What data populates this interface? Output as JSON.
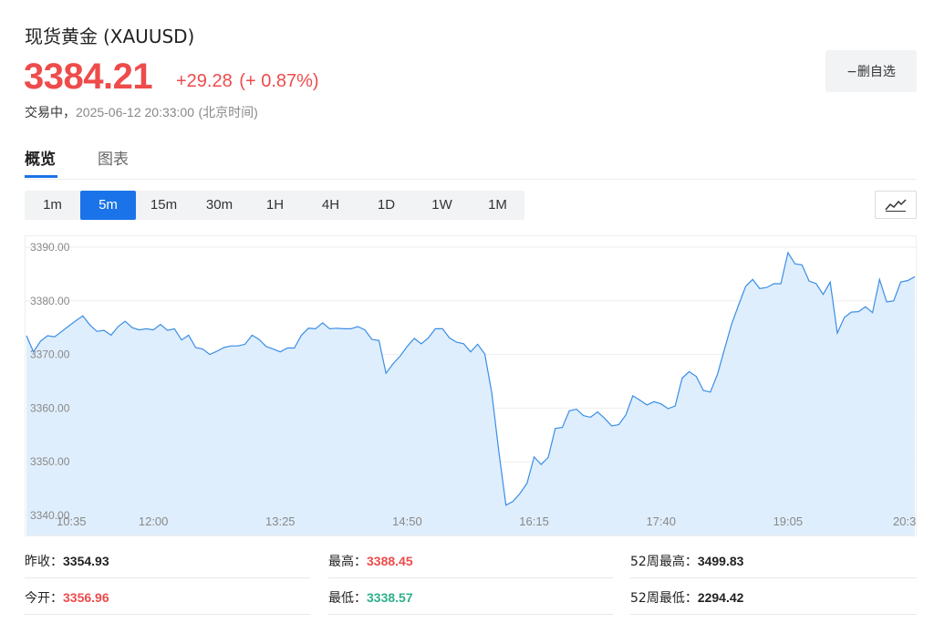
{
  "header": {
    "name": "现货黄金",
    "code": "(XAUUSD)",
    "price": "3384.21",
    "change": "+29.28",
    "change_pct": "(+ 0.87%)",
    "status_label": "交易中，",
    "timestamp": "2025-06-12 20:33:00",
    "timezone": "(北京时间)",
    "up_color": "#ee4b4b"
  },
  "watchlist": {
    "label": "−删自选"
  },
  "tabs": [
    {
      "label": "概览",
      "active": true
    },
    {
      "label": "图表",
      "active": false
    }
  ],
  "intervals": [
    {
      "label": "1m",
      "active": false
    },
    {
      "label": "5m",
      "active": true
    },
    {
      "label": "15m",
      "active": false
    },
    {
      "label": "30m",
      "active": false
    },
    {
      "label": "1H",
      "active": false
    },
    {
      "label": "4H",
      "active": false
    },
    {
      "label": "1D",
      "active": false
    },
    {
      "label": "1W",
      "active": false
    },
    {
      "label": "1M",
      "active": false
    }
  ],
  "chart_type_icon": "line-chart-icon",
  "chart_data": {
    "type": "area",
    "ylim": [
      3340,
      3390
    ],
    "y_ticks": [
      "3390.00",
      "3380.00",
      "3370.00",
      "3360.00",
      "3350.00",
      "3340.00"
    ],
    "x_ticks": [
      {
        "label": "10:35",
        "t": 0
      },
      {
        "label": "12:00",
        "t": 85
      },
      {
        "label": "13:25",
        "t": 170
      },
      {
        "label": "14:50",
        "t": 255
      },
      {
        "label": "16:15",
        "t": 340
      },
      {
        "label": "17:40",
        "t": 425
      },
      {
        "label": "19:05",
        "t": 510
      },
      {
        "label": "20:3",
        "t": 595
      }
    ],
    "x_start": "10:35",
    "x_end": "20:33",
    "interval_minutes": 5,
    "grid": true,
    "line_color": "#3a8ee6",
    "fill_color": "#dfeefc",
    "values": [
      3373.5,
      3370.5,
      3372.5,
      3373.5,
      3373.3,
      3374.3,
      3375.3,
      3376.3,
      3377.2,
      3375.5,
      3374.3,
      3374.5,
      3373.6,
      3375.2,
      3376.2,
      3375.0,
      3374.6,
      3374.8,
      3374.6,
      3375.6,
      3374.5,
      3374.8,
      3372.7,
      3373.6,
      3371.3,
      3371.0,
      3370.0,
      3370.6,
      3371.3,
      3371.6,
      3371.6,
      3371.9,
      3373.6,
      3372.8,
      3371.5,
      3371.0,
      3370.5,
      3371.2,
      3371.2,
      3373.6,
      3374.9,
      3374.8,
      3375.9,
      3374.8,
      3374.9,
      3374.8,
      3374.8,
      3375.2,
      3374.6,
      3372.8,
      3372.6,
      3366.5,
      3368.3,
      3369.7,
      3371.5,
      3373.0,
      3372.0,
      3373.1,
      3374.8,
      3374.8,
      3373.1,
      3372.3,
      3372.0,
      3370.5,
      3371.9,
      3370.1,
      3362.8,
      3351.9,
      3341.9,
      3342.6,
      3344.1,
      3346.0,
      3350.9,
      3349.5,
      3350.8,
      3356.2,
      3356.4,
      3359.5,
      3359.8,
      3358.6,
      3358.3,
      3359.3,
      3358.1,
      3356.7,
      3356.9,
      3358.7,
      3362.3,
      3361.5,
      3360.6,
      3361.2,
      3360.8,
      3359.9,
      3360.4,
      3365.6,
      3366.8,
      3365.9,
      3363.3,
      3363.0,
      3366.3,
      3371.0,
      3375.6,
      3379.2,
      3382.7,
      3384.0,
      3382.3,
      3382.5,
      3383.2,
      3383.2,
      3389.0,
      3386.9,
      3386.7,
      3383.7,
      3383.2,
      3381.2,
      3383.5,
      3374.0,
      3376.9,
      3377.9,
      3378.0,
      3378.9,
      3377.8,
      3384.0,
      3379.8,
      3380.0,
      3383.5,
      3383.8,
      3384.5
    ]
  },
  "stats": [
    [
      {
        "label": "昨收：",
        "value": "3354.93",
        "tone": "dark"
      },
      {
        "label": "最高：",
        "value": "3388.45",
        "tone": "red"
      },
      {
        "label": "52周最高：",
        "value": "3499.83",
        "tone": "dark"
      }
    ],
    [
      {
        "label": "今开：",
        "value": "3356.96",
        "tone": "red"
      },
      {
        "label": "最低：",
        "value": "3338.57",
        "tone": "green"
      },
      {
        "label": "52周最低：",
        "value": "2294.42",
        "tone": "dark"
      }
    ]
  ]
}
